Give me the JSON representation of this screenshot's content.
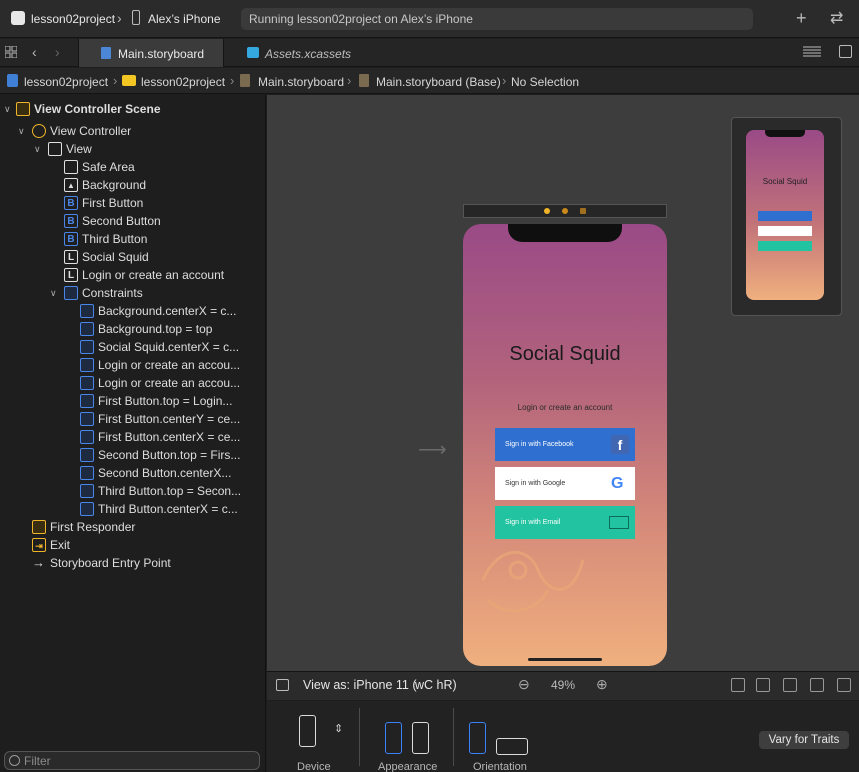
{
  "toolbar": {
    "scheme": "lesson02project",
    "device": "Alex’s iPhone",
    "activity": "Running lesson02project on Alex’s iPhone"
  },
  "tabs": [
    {
      "label": "Main.storyboard",
      "active": true
    },
    {
      "label": "Assets.xcassets",
      "active": false
    }
  ],
  "breadcrumb": [
    "lesson02project",
    "lesson02project",
    "Main.storyboard",
    "Main.storyboard (Base)",
    "No Selection"
  ],
  "outline": {
    "scene": "View Controller Scene",
    "controller": "View Controller",
    "view": "View",
    "children": [
      "Safe Area",
      "Background",
      "First Button",
      "Second Button",
      "Third Button",
      "Social Squid",
      "Login or create an account"
    ],
    "constraints_label": "Constraints",
    "constraints": [
      "Background.centerX = c...",
      "Background.top = top",
      "Social Squid.centerX = c...",
      "Login or create an accou...",
      "Login or create an accou...",
      "First Button.top = Login...",
      "First Button.centerY = ce...",
      "First Button.centerX = ce...",
      "Second Button.top = Firs...",
      "Second Button.centerX...",
      "Third Button.top = Secon...",
      "Third Button.centerX = c..."
    ],
    "first_responder": "First Responder",
    "exit": "Exit",
    "entry_point": "Storyboard Entry Point"
  },
  "filter": {
    "placeholder": "Filter"
  },
  "app": {
    "title": "Social Squid",
    "subtitle": "Login or create an account",
    "btn_facebook": "Sign in with Facebook",
    "btn_google": "Sign in with Google",
    "btn_email": "Sign in with Email",
    "fb_glyph": "f",
    "g_glyph": "G"
  },
  "bottom": {
    "view_as": "View as: iPhone 11 (",
    "traits": "wC hR)",
    "zoom": "49%",
    "zoom_out_glyph": "⊖",
    "zoom_in_glyph": "⊕"
  },
  "config": {
    "device": "Device",
    "appearance": "Appearance",
    "orientation": "Orientation",
    "vary": "Vary for Traits"
  },
  "colors": {
    "accent": "#3b82f6",
    "facebook": "#2f6fcf",
    "email": "#22c3a0",
    "gradient_top": "#9a4a86",
    "gradient_bottom": "#f0b07e"
  }
}
